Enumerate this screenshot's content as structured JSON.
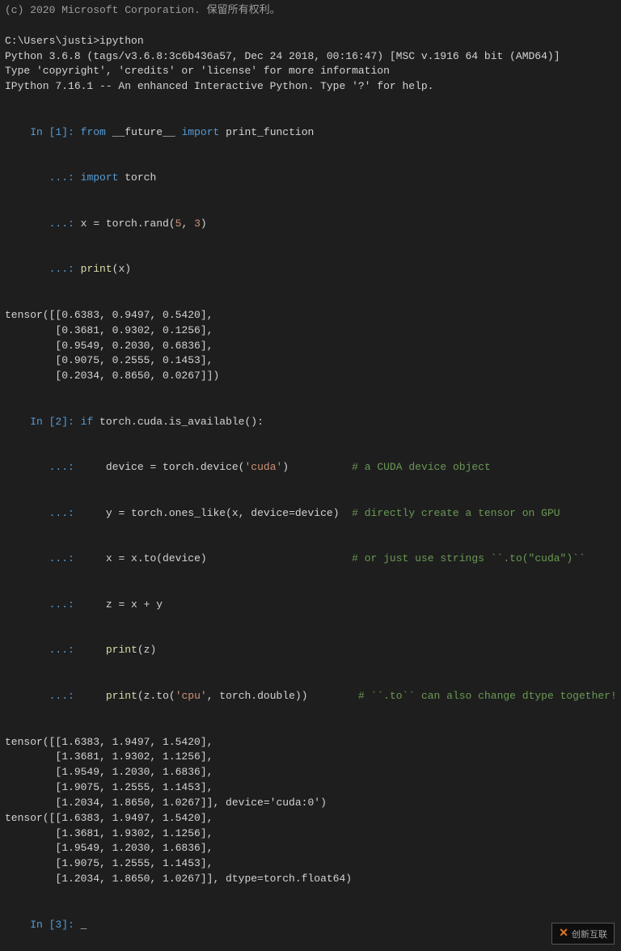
{
  "terminal": {
    "header_line": "(c) 2020 Microsoft Corporation. 保留所有权利。",
    "blank1": "",
    "path_line": "C:\\Users\\justi>ipython",
    "python_info": "Python 3.6.8 (tags/v3.6.8:3c6b436a57, Dec 24 2018, 00:16:47) [MSC v.1916 64 bit (AMD64)]",
    "type_line": "Type 'copyright', 'credits' or 'license' for more information",
    "ipython_line": "IPython 7.16.1 -- An enhanced Interactive Python. Type '?' for help.",
    "blank2": "",
    "in1_prompt": "In [1]: ",
    "in1_code1": "from __future__ import print_function",
    "in1_cont1": "   ...: import torch",
    "in1_cont2": "   ...: x = torch.rand(5, 3)",
    "in1_cont3": "   ...: print(x)",
    "blank3": "",
    "tensor1_line1": "tensor([[0.6383, 0.9497, 0.5420],",
    "tensor1_line2": "        [0.3681, 0.9302, 0.1256],",
    "tensor1_line3": "        [0.9549, 0.2030, 0.6836],",
    "tensor1_line4": "        [0.9075, 0.2555, 0.1453],",
    "tensor1_line5": "        [0.2034, 0.8650, 0.0267]])",
    "blank4": "",
    "in2_prompt": "In [2]: ",
    "in2_code1": "if torch.cuda.is_available():",
    "in2_cont1": "   ...:     device = torch.device('cuda')          # a CUDA device object",
    "in2_cont2": "   ...:     y = torch.ones_like(x, device=device)  # directly create a tensor on GPU",
    "in2_cont3": "   ...:     x = x.to(device)                       # or just use strings ``.to(\"cuda\")``",
    "in2_cont4": "   ...:     z = x + y",
    "in2_cont5": "   ...:     print(z)",
    "in2_cont6": "   ...:     print(z.to('cpu', torch.double))        # ``.to`` can also change dtype together!",
    "blank5": "",
    "tensor2_line1": "tensor([[1.6383, 1.9497, 1.5420],",
    "tensor2_line2": "        [1.3681, 1.9302, 1.1256],",
    "tensor2_line3": "        [1.9549, 1.2030, 1.6836],",
    "tensor2_line4": "        [1.9075, 1.2555, 1.1453],",
    "tensor2_line5": "        [1.2034, 1.8650, 1.0267]], device='cuda:0')",
    "tensor3_line1": "tensor([[1.6383, 1.9497, 1.5420],",
    "tensor3_line2": "        [1.3681, 1.9302, 1.1256],",
    "tensor3_line3": "        [1.9549, 1.2030, 1.6836],",
    "tensor3_line4": "        [1.9075, 1.2555, 1.1453],",
    "tensor3_line5": "        [1.2034, 1.8650, 1.0267]], dtype=torch.float64)",
    "blank6": "",
    "in3_prompt": "In [3]: _",
    "watermark_text": "创新互联",
    "watermark_icon": "✕"
  }
}
